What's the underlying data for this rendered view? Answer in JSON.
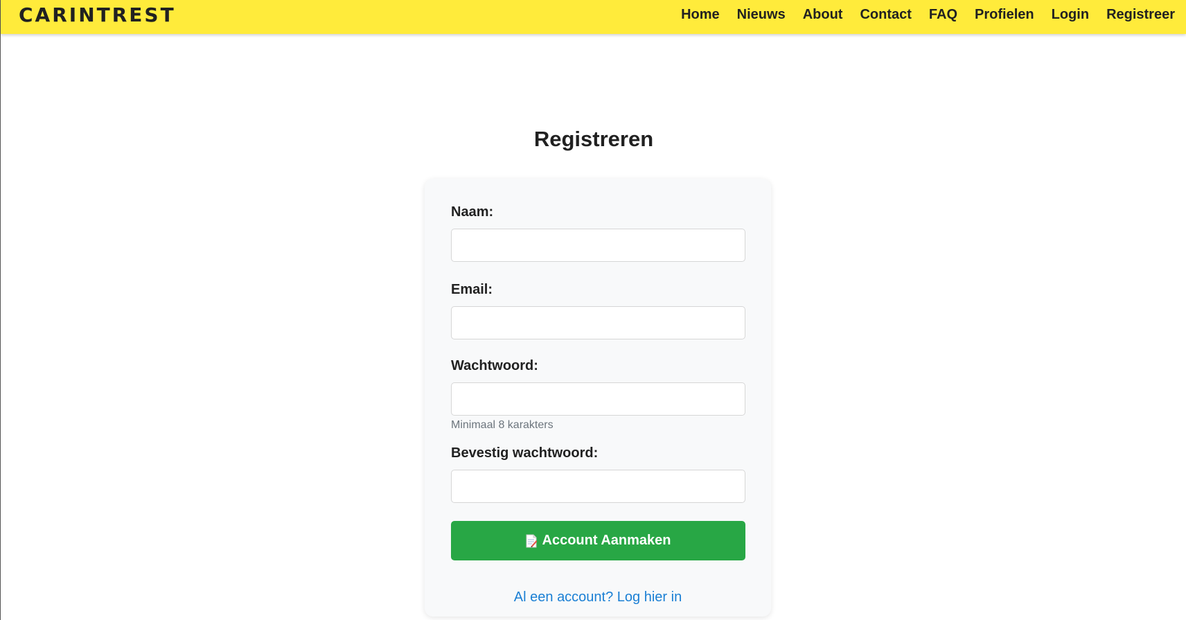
{
  "brand": "CARINTREST",
  "nav": [
    "Home",
    "Nieuws",
    "About",
    "Contact",
    "FAQ",
    "Profielen",
    "Login",
    "Registreer"
  ],
  "page_title": "Registreren",
  "form": {
    "name_label": "Naam:",
    "name_value": "",
    "email_label": "Email:",
    "email_value": "",
    "password_label": "Wachtwoord:",
    "password_value": "",
    "password_hint": "Minimaal 8 karakters",
    "confirm_label": "Bevestig wachtwoord:",
    "confirm_value": "",
    "submit_label": "Account Aanmaken",
    "submit_icon": "memo-icon",
    "login_link": "Al een account? Log hier in"
  },
  "colors": {
    "navbar": "#ffeb3b",
    "submit": "#28a745",
    "link": "#1a7fd4"
  }
}
